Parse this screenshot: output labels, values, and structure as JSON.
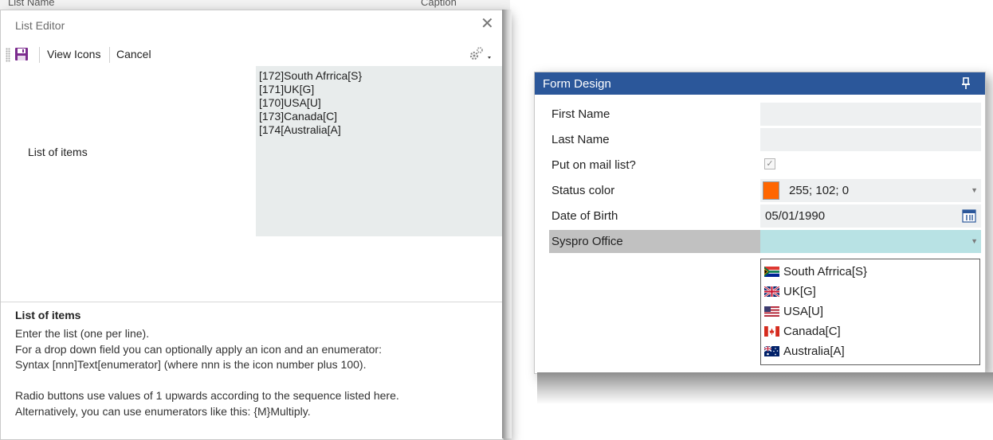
{
  "background": {
    "top_left_fragment": "List Name",
    "top_right_fragment": "Caption"
  },
  "list_editor": {
    "title": "List Editor",
    "toolbar": {
      "save_icon": "save-icon",
      "view_icons_label": "View Icons",
      "cancel_label": "Cancel",
      "settings_icon": "gear-icon"
    },
    "field_label": "List of items",
    "list_lines": [
      "[172]South Afrrica[S}",
      "[171]UK[G]",
      "[170]USA[U]",
      "[173]Canada[C]",
      "[174[Australia[A]"
    ],
    "help": {
      "title": "List of items",
      "lines": [
        "Enter the list (one per line).",
        "For a drop down field you can optionally apply an icon and an enumerator:",
        "Syntax  [nnn]Text[enumerator]   (where nnn is the icon number plus 100).",
        "",
        "Radio buttons use values of 1 upwards according to the sequence listed here.",
        "Alternatively, you can use enumerators like this: {M}Multiply."
      ]
    }
  },
  "form_design": {
    "title": "Form Design",
    "pin_icon": "pin-icon",
    "fields": [
      {
        "label": "First Name",
        "value": ""
      },
      {
        "label": "Last Name",
        "value": ""
      },
      {
        "label": "Put on mail list?",
        "checked": true,
        "check_glyph": "✓"
      },
      {
        "label": "Status color",
        "value": "255; 102; 0",
        "color": "#ff6600"
      },
      {
        "label": "Date of Birth",
        "value": "05/01/1990"
      },
      {
        "label": "Syspro Office",
        "value": ""
      }
    ],
    "dropdown_options": [
      {
        "label": "South Afrrica[S}",
        "flag": "south-africa-flag-icon"
      },
      {
        "label": "UK[G]",
        "flag": "uk-flag-icon"
      },
      {
        "label": "USA[U]",
        "flag": "usa-flag-icon"
      },
      {
        "label": "Canada[C]",
        "flag": "canada-flag-icon"
      },
      {
        "label": "Australia[A]",
        "flag": "australia-flag-icon"
      }
    ],
    "colors": {
      "title_bar": "#2b579a",
      "selected_field": "#b8e2e4",
      "selected_label": "#c1c1c1"
    }
  }
}
